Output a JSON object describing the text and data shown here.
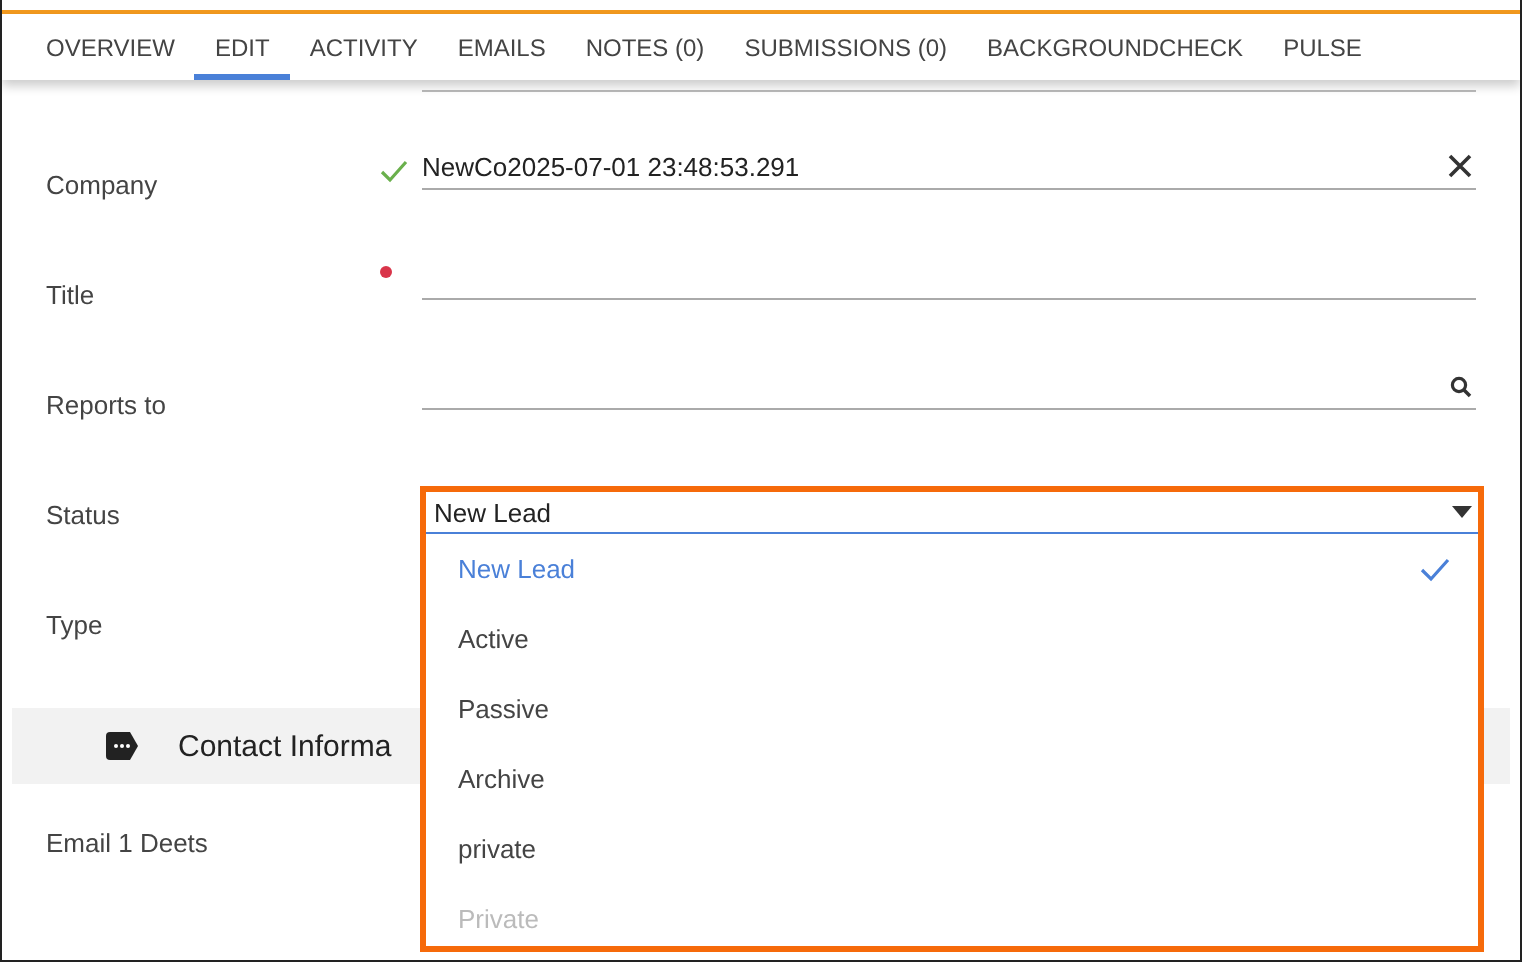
{
  "tabs": [
    {
      "label": "OVERVIEW",
      "selected": false
    },
    {
      "label": "EDIT",
      "selected": true
    },
    {
      "label": "ACTIVITY",
      "selected": false
    },
    {
      "label": "EMAILS",
      "selected": false
    },
    {
      "label": "NOTES (0)",
      "selected": false
    },
    {
      "label": "SUBMISSIONS (0)",
      "selected": false
    },
    {
      "label": "BACKGROUNDCHECK",
      "selected": false
    },
    {
      "label": "PULSE",
      "selected": false
    }
  ],
  "fields": [
    {
      "label": "Company",
      "value": "NewCo2025-07-01 23:48:53.291",
      "valid": true,
      "required": false,
      "clearable": true,
      "searchable": false
    },
    {
      "label": "Title",
      "valid": false,
      "required": true,
      "clearable": false,
      "searchable": false
    },
    {
      "label": "Reports to",
      "valid": false,
      "required": false,
      "clearable": false,
      "searchable": true
    }
  ],
  "select_rows": [
    {
      "label": "Status"
    },
    {
      "label": "Type"
    }
  ],
  "section": {
    "title": "Contact Informa"
  },
  "fields_2": [
    {
      "label": "Email 1 Deets"
    }
  ],
  "status_dropdown": {
    "value": "New Lead",
    "options": [
      {
        "label": "New Lead",
        "selected": true,
        "disabled": false
      },
      {
        "label": "Active",
        "selected": false,
        "disabled": false
      },
      {
        "label": "Passive",
        "selected": false,
        "disabled": false
      },
      {
        "label": "Archive",
        "selected": false,
        "disabled": false
      },
      {
        "label": "private",
        "selected": false,
        "disabled": false
      },
      {
        "label": "Private",
        "selected": false,
        "disabled": true
      }
    ]
  }
}
